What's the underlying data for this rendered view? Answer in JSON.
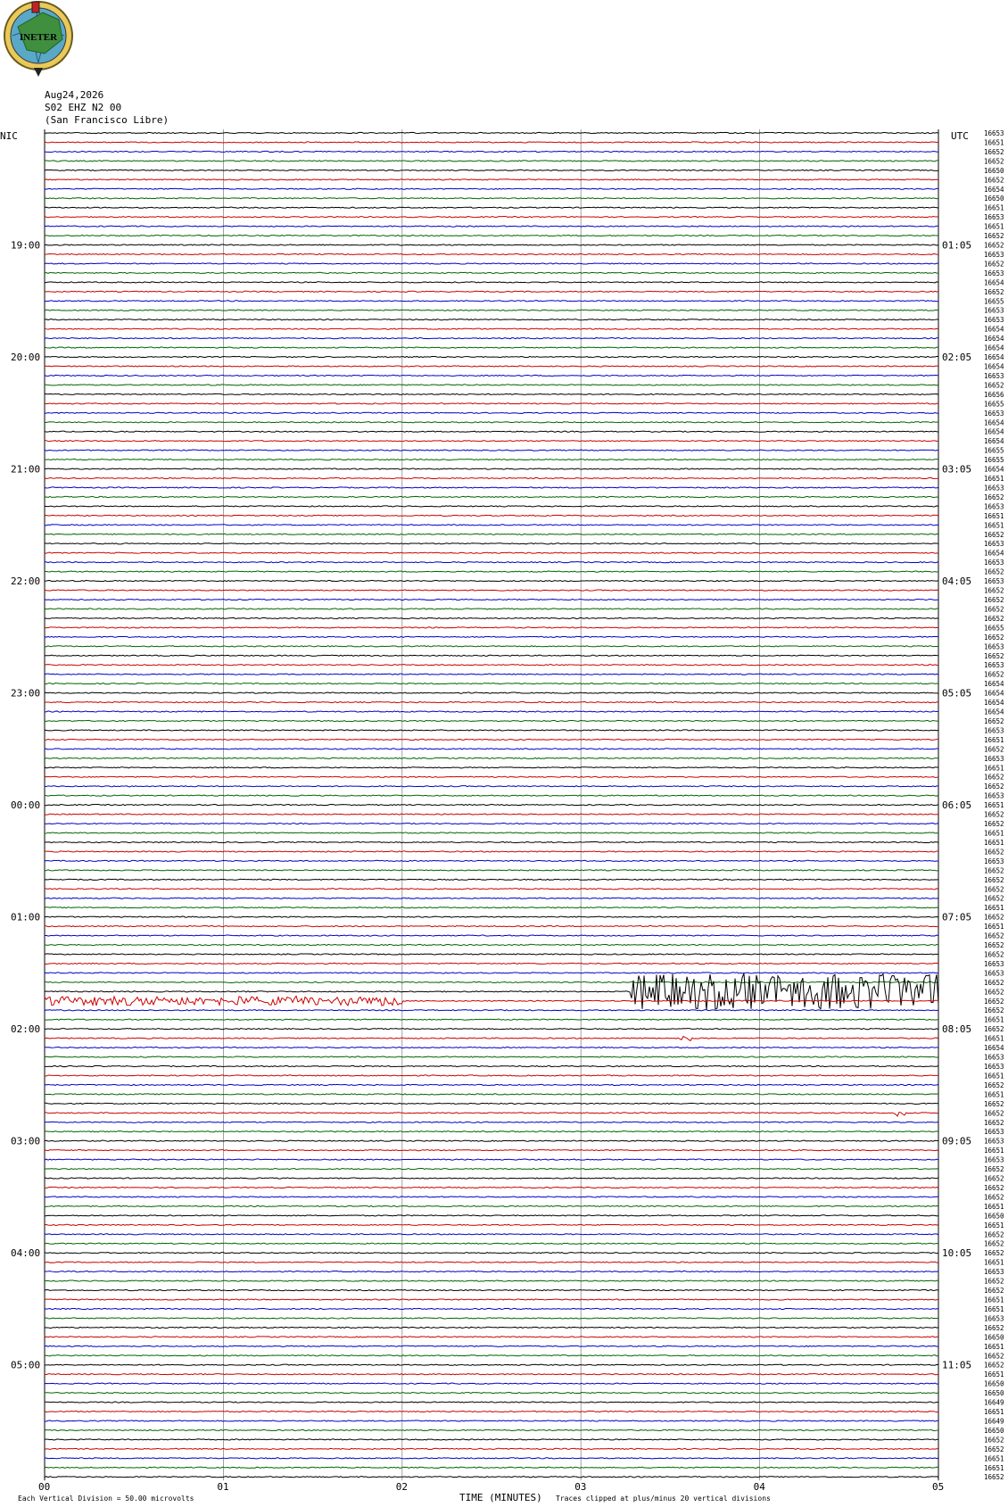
{
  "logo": {
    "text": "INETER"
  },
  "header": {
    "date": "Aug24,2026",
    "station": "S02 EHZ N2 00",
    "location": "(San Francisco Libre)"
  },
  "chart_data": {
    "type": "seismogram",
    "left_tz": "NIC",
    "right_tz": "UTC",
    "xlabel": "TIME (MINUTES)",
    "x_ticks": [
      "00",
      "01",
      "02",
      "03",
      "04",
      "05"
    ],
    "xlim": [
      0,
      5
    ],
    "trace_colors": [
      "#000000",
      "#cc0000",
      "#0000cc",
      "#006600"
    ],
    "trace_count": 145,
    "first_hour_row": 12,
    "rows_per_hour": 12,
    "left_hour_labels": [
      "19:00",
      "20:00",
      "21:00",
      "22:00",
      "23:00",
      "00:00",
      "01:00",
      "02:00",
      "03:00",
      "04:00",
      "05:00"
    ],
    "right_hour_labels": [
      "01:05",
      "02:05",
      "03:05",
      "04:05",
      "05:05",
      "06:05",
      "07:05",
      "08:05",
      "09:05",
      "10:05",
      "11:05"
    ],
    "right_values": [
      "16653",
      "16651",
      "16652",
      "16652",
      "16650",
      "16652",
      "16654",
      "16650",
      "16651",
      "16653",
      "16651",
      "16652",
      "16652",
      "16653",
      "16652",
      "16653",
      "16654",
      "16652",
      "16655",
      "16653",
      "16653",
      "16654",
      "16654",
      "16654",
      "16654",
      "16654",
      "16653",
      "16652",
      "16656",
      "16655",
      "16653",
      "16654",
      "16654",
      "16654",
      "16655",
      "16655",
      "16654",
      "16651",
      "16653",
      "16652",
      "16653",
      "16651",
      "16651",
      "16652",
      "16653",
      "16654",
      "16653",
      "16652",
      "16653",
      "16652",
      "16652",
      "16652",
      "16652",
      "16655",
      "16652",
      "16653",
      "16652",
      "16653",
      "16652",
      "16654",
      "16654",
      "16654",
      "16654",
      "16652",
      "16653",
      "16651",
      "16652",
      "16653",
      "16651",
      "16652",
      "16652",
      "16653",
      "16651",
      "16652",
      "16652",
      "16651",
      "16651",
      "16652",
      "16653",
      "16652",
      "16652",
      "16652",
      "16652",
      "16651",
      "16652",
      "16651",
      "16652",
      "16652",
      "16652",
      "16653",
      "16653",
      "16652",
      "16652",
      "16652",
      "16652",
      "16651",
      "16652",
      "16651",
      "16654",
      "16653",
      "16653",
      "16651",
      "16652",
      "16651",
      "16652",
      "16652",
      "16652",
      "16653",
      "16653",
      "16651",
      "16653",
      "16652",
      "16652",
      "16652",
      "16652",
      "16651",
      "16650",
      "16651",
      "16652",
      "16652",
      "16652",
      "16651",
      "16653",
      "16652",
      "16652",
      "16651",
      "16651",
      "16653",
      "16652",
      "16650",
      "16651",
      "16652",
      "16652",
      "16651",
      "16650",
      "16650",
      "16649",
      "16651",
      "16649",
      "16650",
      "16652",
      "16652",
      "16651",
      "16651",
      "16652"
    ],
    "events": [
      {
        "row": 92,
        "start_min": 3.28,
        "end_min": 5.0,
        "amplitude": 1.0
      },
      {
        "row": 93,
        "start_min": 0.0,
        "end_min": 2.0,
        "amplitude": 0.25
      },
      {
        "row": 97,
        "start_min": 3.55,
        "end_min": 3.62,
        "amplitude": 0.6
      },
      {
        "row": 105,
        "start_min": 4.75,
        "end_min": 4.82,
        "amplitude": 0.6
      }
    ],
    "footer_left": "Each Vertical Division =    50.00 microvolts",
    "footer_right": "Traces clipped at plus/minus 20 vertical divisions"
  }
}
